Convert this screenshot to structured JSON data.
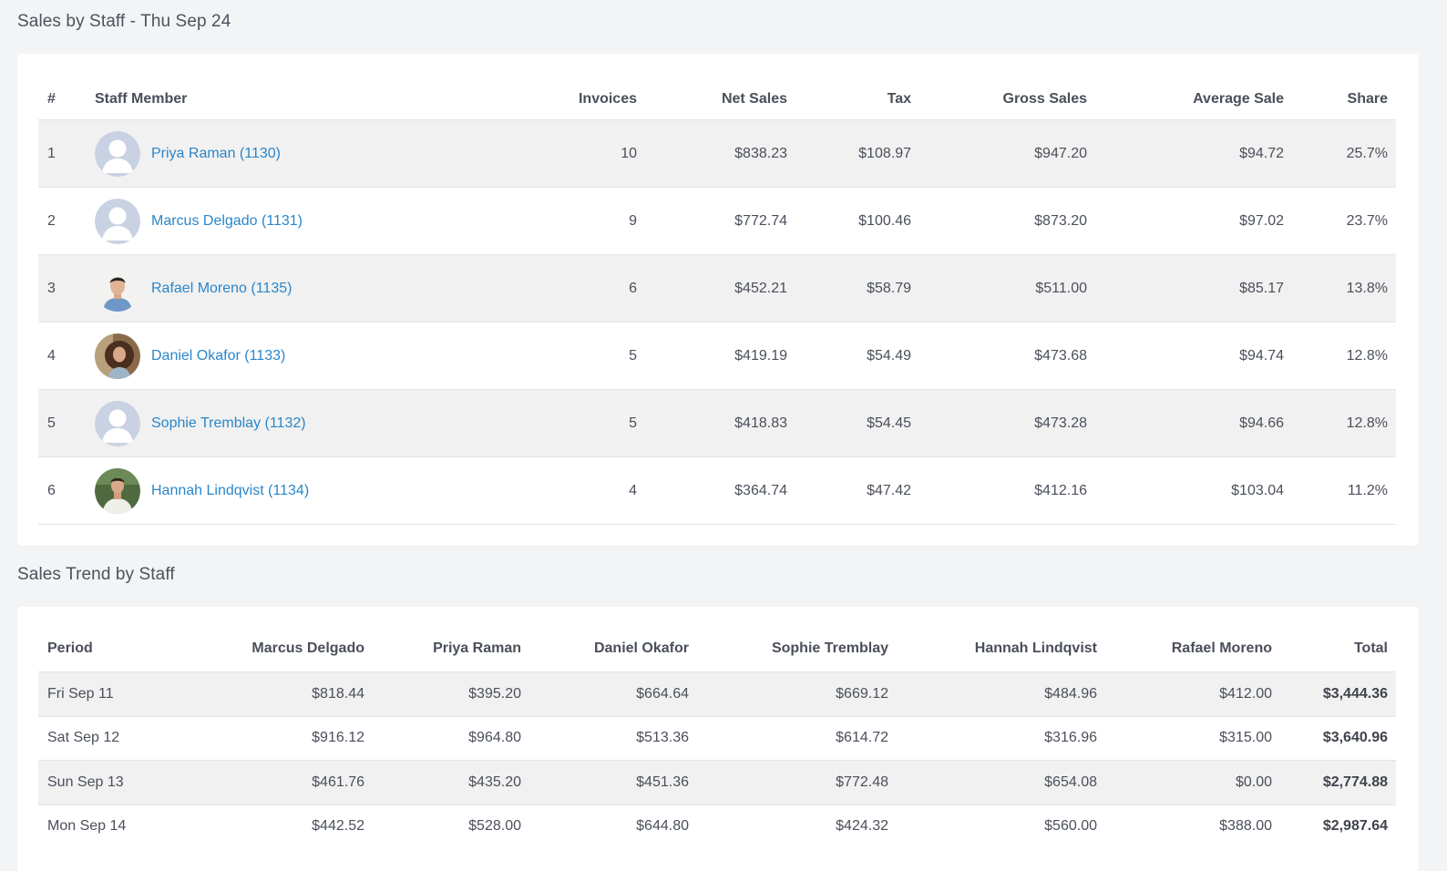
{
  "staff_section": {
    "title": "Sales by Staff - Thu Sep 24",
    "columns": [
      "#",
      "Staff Member",
      "Invoices",
      "Net Sales",
      "Tax",
      "Gross Sales",
      "Average Sale",
      "Share"
    ],
    "rows": [
      {
        "rank": "1",
        "name": "Priya Raman (1130)",
        "avatar": "placeholder-avatar",
        "invoices": "10",
        "net": "$838.23",
        "tax": "$108.97",
        "gross": "$947.20",
        "avg": "$94.72",
        "share": "25.7%"
      },
      {
        "rank": "2",
        "name": "Marcus Delgado (1131)",
        "avatar": "placeholder-avatar",
        "invoices": "9",
        "net": "$772.74",
        "tax": "$100.46",
        "gross": "$873.20",
        "avg": "$97.02",
        "share": "23.7%"
      },
      {
        "rank": "3",
        "name": "Rafael Moreno (1135)",
        "avatar": "photo-avatar-man-blue-shirt",
        "invoices": "6",
        "net": "$452.21",
        "tax": "$58.79",
        "gross": "$511.00",
        "avg": "$85.17",
        "share": "13.8%"
      },
      {
        "rank": "4",
        "name": "Daniel Okafor (1133)",
        "avatar": "photo-avatar-woman-curly-hair",
        "invoices": "5",
        "net": "$419.19",
        "tax": "$54.49",
        "gross": "$473.68",
        "avg": "$94.74",
        "share": "12.8%"
      },
      {
        "rank": "5",
        "name": "Sophie Tremblay (1132)",
        "avatar": "placeholder-avatar",
        "invoices": "5",
        "net": "$418.83",
        "tax": "$54.45",
        "gross": "$473.28",
        "avg": "$94.66",
        "share": "12.8%"
      },
      {
        "rank": "6",
        "name": "Hannah Lindqvist (1134)",
        "avatar": "photo-avatar-man-white-shirt",
        "invoices": "4",
        "net": "$364.74",
        "tax": "$47.42",
        "gross": "$412.16",
        "avg": "$103.04",
        "share": "11.2%"
      }
    ]
  },
  "trend_section": {
    "title": "Sales Trend by Staff",
    "columns": [
      "Period",
      "Marcus Delgado",
      "Priya Raman",
      "Daniel Okafor",
      "Sophie Tremblay",
      "Hannah Lindqvist",
      "Rafael Moreno",
      "Total"
    ],
    "rows": [
      {
        "period": "Fri Sep 11",
        "values": [
          "$818.44",
          "$395.20",
          "$664.64",
          "$669.12",
          "$484.96",
          "$412.00"
        ],
        "total": "$3,444.36"
      },
      {
        "period": "Sat Sep 12",
        "values": [
          "$916.12",
          "$964.80",
          "$513.36",
          "$614.72",
          "$316.96",
          "$315.00"
        ],
        "total": "$3,640.96"
      },
      {
        "period": "Sun Sep 13",
        "values": [
          "$461.76",
          "$435.20",
          "$451.36",
          "$772.48",
          "$654.08",
          "$0.00"
        ],
        "total": "$2,774.88"
      },
      {
        "period": "Mon Sep 14",
        "values": [
          "$442.52",
          "$528.00",
          "$644.80",
          "$424.32",
          "$560.00",
          "$388.00"
        ],
        "total": "$2,987.64"
      }
    ]
  },
  "colors": {
    "link": "#2a86c9",
    "stripe": "#f1f1f1",
    "background": "#f3f4f6"
  }
}
